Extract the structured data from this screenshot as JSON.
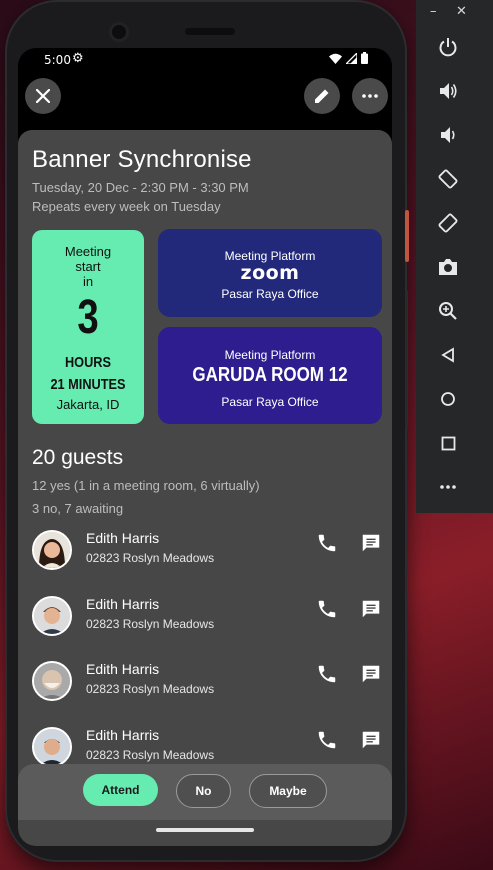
{
  "status_bar": {
    "time": "5:00"
  },
  "event": {
    "title": "Banner Synchronise",
    "datetime": "Tuesday, 20 Dec - 2:30 PM - 3:30 PM",
    "repeat": "Repeats every week on Tuesday"
  },
  "countdown": {
    "line1": "Meeting",
    "line2": "start",
    "line3": "in",
    "number": "3",
    "hours": "HOURS",
    "minutes": "21 MINUTES",
    "location": "Jakarta, ID",
    "color": "#66ebb1"
  },
  "platforms": [
    {
      "label": "Meeting Platform",
      "name": "zoom",
      "office": "Pasar Raya Office",
      "color": "#23297a"
    },
    {
      "label": "Meeting Platform",
      "name": "GARUDA ROOM 12",
      "office": "Pasar Raya Office",
      "color": "#2e1d8f"
    }
  ],
  "guests": {
    "heading": "20 guests",
    "summary1": "12 yes (1 in a meeting room, 6 virtually)",
    "summary2": "3 no, 7 awaiting",
    "list": [
      {
        "name": "Edith Harris",
        "address": "02823 Roslyn Meadows"
      },
      {
        "name": "Edith Harris",
        "address": "02823 Roslyn Meadows"
      },
      {
        "name": "Edith Harris",
        "address": "02823 Roslyn Meadows"
      },
      {
        "name": "Edith Harris",
        "address": "02823 Roslyn Meadows"
      }
    ]
  },
  "rsvp": {
    "attend": "Attend",
    "no": "No",
    "maybe": "Maybe",
    "accent": "#66ebb1"
  },
  "toolbar": {
    "icons": [
      "power-icon",
      "volume-up-icon",
      "volume-down-icon",
      "rotate-left-icon",
      "rotate-right-icon",
      "camera-icon",
      "zoom-icon",
      "back-icon",
      "home-icon",
      "overview-icon",
      "more-icon"
    ]
  }
}
